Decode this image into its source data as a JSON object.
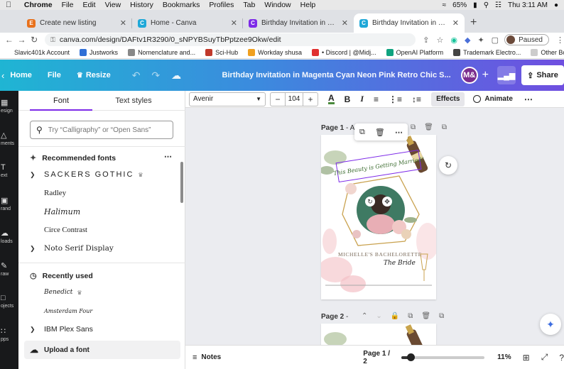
{
  "menubar": {
    "app": "Chrome",
    "items": [
      "File",
      "Edit",
      "View",
      "History",
      "Bookmarks",
      "Profiles",
      "Tab",
      "Window",
      "Help"
    ],
    "battery": "65%",
    "clock": "Thu 3:11 AM"
  },
  "tabs": [
    {
      "title": "Create new listing",
      "color": "#e8711c",
      "glyph": "E"
    },
    {
      "title": "Home - Canva",
      "color": "#1fa8d8",
      "glyph": "C"
    },
    {
      "title": "Birthday Invitation in Magenta",
      "color": "#7d2ae8",
      "glyph": "C"
    },
    {
      "title": "Birthday Invitation in Magenta",
      "color": "#1fa8d8",
      "glyph": "C"
    }
  ],
  "address": {
    "url": "canva.com/design/DAFtv1R3290/0_sNPYBSuyTbPptzee9Okw/edit",
    "paused": "Paused"
  },
  "bookmarks": [
    {
      "label": "Slavic401k Account",
      "color": "#ffffff"
    },
    {
      "label": "Justworks",
      "color": "#2f6fd6"
    },
    {
      "label": "Nomenclature and...",
      "color": "#888888"
    },
    {
      "label": "Sci-Hub",
      "color": "#c0392b"
    },
    {
      "label": "Workday shusa",
      "color": "#f0a020"
    },
    {
      "label": "• Discord | @Midj...",
      "color": "#e03030"
    },
    {
      "label": "OpenAI Platform",
      "color": "#10a37f"
    },
    {
      "label": "Trademark Electro...",
      "color": "#444444"
    },
    {
      "label": "Other Bookmarks",
      "color": "#cccccc"
    }
  ],
  "header": {
    "home": "Home",
    "file": "File",
    "resize": "Resize",
    "title": "Birthday Invitation in Magenta Cyan Neon Pink Retro Chic S...",
    "avatar": "M&",
    "share": "Share"
  },
  "rail": [
    "esign",
    "ments",
    "ext",
    "rand",
    "loads",
    "raw",
    "ojects",
    "pps"
  ],
  "panel": {
    "tab_font": "Font",
    "tab_styles": "Text styles",
    "search_placeholder": "Try “Calligraphy” or “Open Sans”",
    "recommended": "Recommended fonts",
    "fonts": [
      "Sackers Gothic",
      "Radley",
      "Halimum",
      "Circe Contrast",
      "Noto Serif Display"
    ],
    "recent_header": "Recently used",
    "recent": [
      "Benedict",
      "Amsterdam Four",
      "IBM Plex Sans"
    ],
    "upload": "Upload a font"
  },
  "toolbar": {
    "font": "Avenir",
    "size": "104",
    "effects": "Effects",
    "animate": "Animate",
    "text_color": "#4a8a3c"
  },
  "canvas": {
    "page1_label": "Page 1",
    "page1_suffix": "- A...",
    "page2_label": "Page 2",
    "page2_suffix": "-",
    "headline": "This Beauty is Getting Married!",
    "bachelorette": "MICHELLE'S BACHELORETTE",
    "bride": "The Bride"
  },
  "bottom": {
    "notes": "Notes",
    "page_indicator": "Page 1 / 2",
    "zoom": "11%",
    "zoom_level": 0.11
  }
}
